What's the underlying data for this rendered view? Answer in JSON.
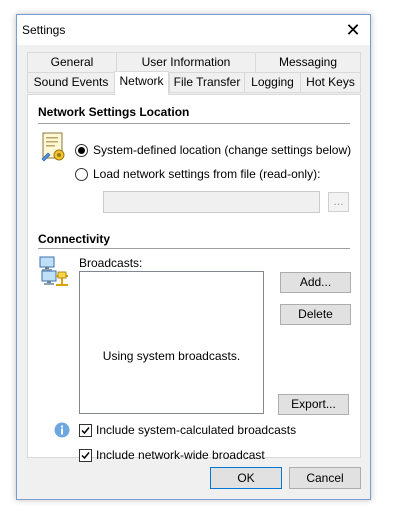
{
  "window": {
    "title": "Settings",
    "close_glyph": "✕"
  },
  "tabs": {
    "row_back": [
      "General",
      "User Information",
      "Messaging"
    ],
    "row_front": [
      "Sound Events",
      "Network",
      "File Transfer",
      "Logging",
      "Hot Keys"
    ],
    "active": "Network"
  },
  "location": {
    "title": "Network Settings Location",
    "icon": "network-settings-icon",
    "option_system": "System-defined location (change settings below)",
    "option_file": "Load network settings from file (read-only):",
    "selected": "system",
    "file_path_value": "",
    "browse_label": "..."
  },
  "connectivity": {
    "title": "Connectivity",
    "icon": "network-computers-icon",
    "broadcasts_label": "Broadcasts:",
    "list_message": "Using system broadcasts.",
    "add_label": "Add...",
    "delete_label": "Delete",
    "export_label": "Export...",
    "info_icon": "info-icon",
    "check_system_calc": {
      "label": "Include system-calculated broadcasts",
      "checked": true
    },
    "check_network_wide": {
      "label": "Include network-wide broadcast",
      "checked": true
    }
  },
  "footer": {
    "ok_label": "OK",
    "cancel_label": "Cancel"
  }
}
